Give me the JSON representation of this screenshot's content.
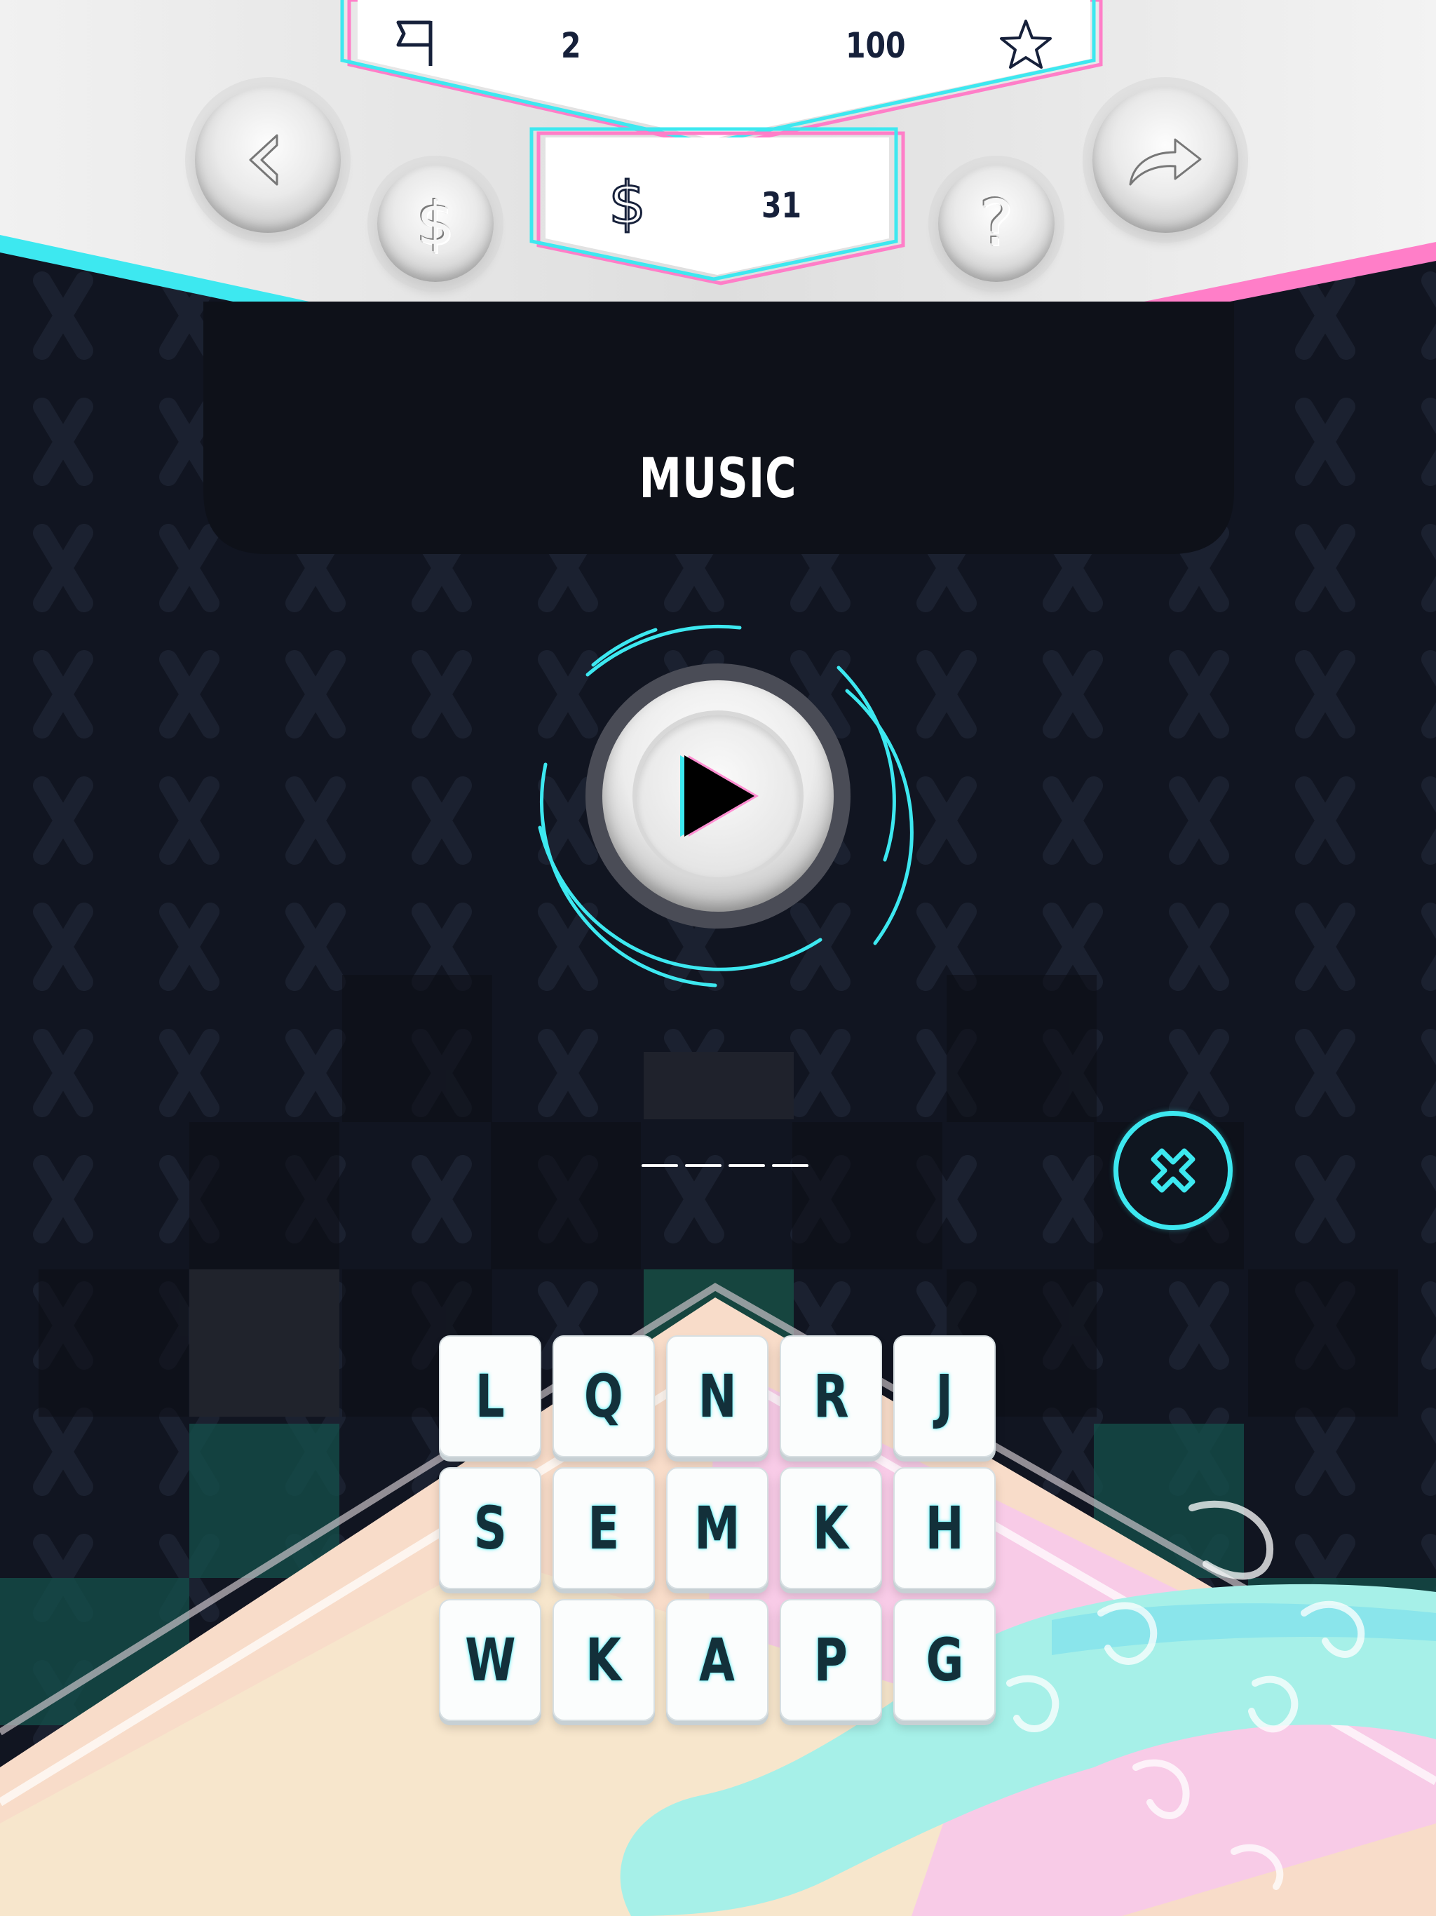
{
  "hud": {
    "level": "2",
    "score": "100",
    "coins": "31",
    "icons": {
      "level": "flag-icon",
      "score": "star-icon",
      "coins": "dollar-icon",
      "back": "chevron-left-icon",
      "shop": "dollar-icon",
      "hint": "question-icon",
      "share": "share-arrow-icon"
    }
  },
  "category": "MUSIC",
  "answer": {
    "slot_count": 4,
    "clear_icon": "close-icon"
  },
  "letters": [
    "L",
    "Q",
    "N",
    "R",
    "J",
    "S",
    "E",
    "M",
    "K",
    "H",
    "W",
    "K",
    "A",
    "P",
    "G"
  ],
  "colors": {
    "accent_cyan": "#3de8f0",
    "accent_pink": "#ff6fc0",
    "background": "#111521",
    "tile_glyph": "#13303a"
  }
}
